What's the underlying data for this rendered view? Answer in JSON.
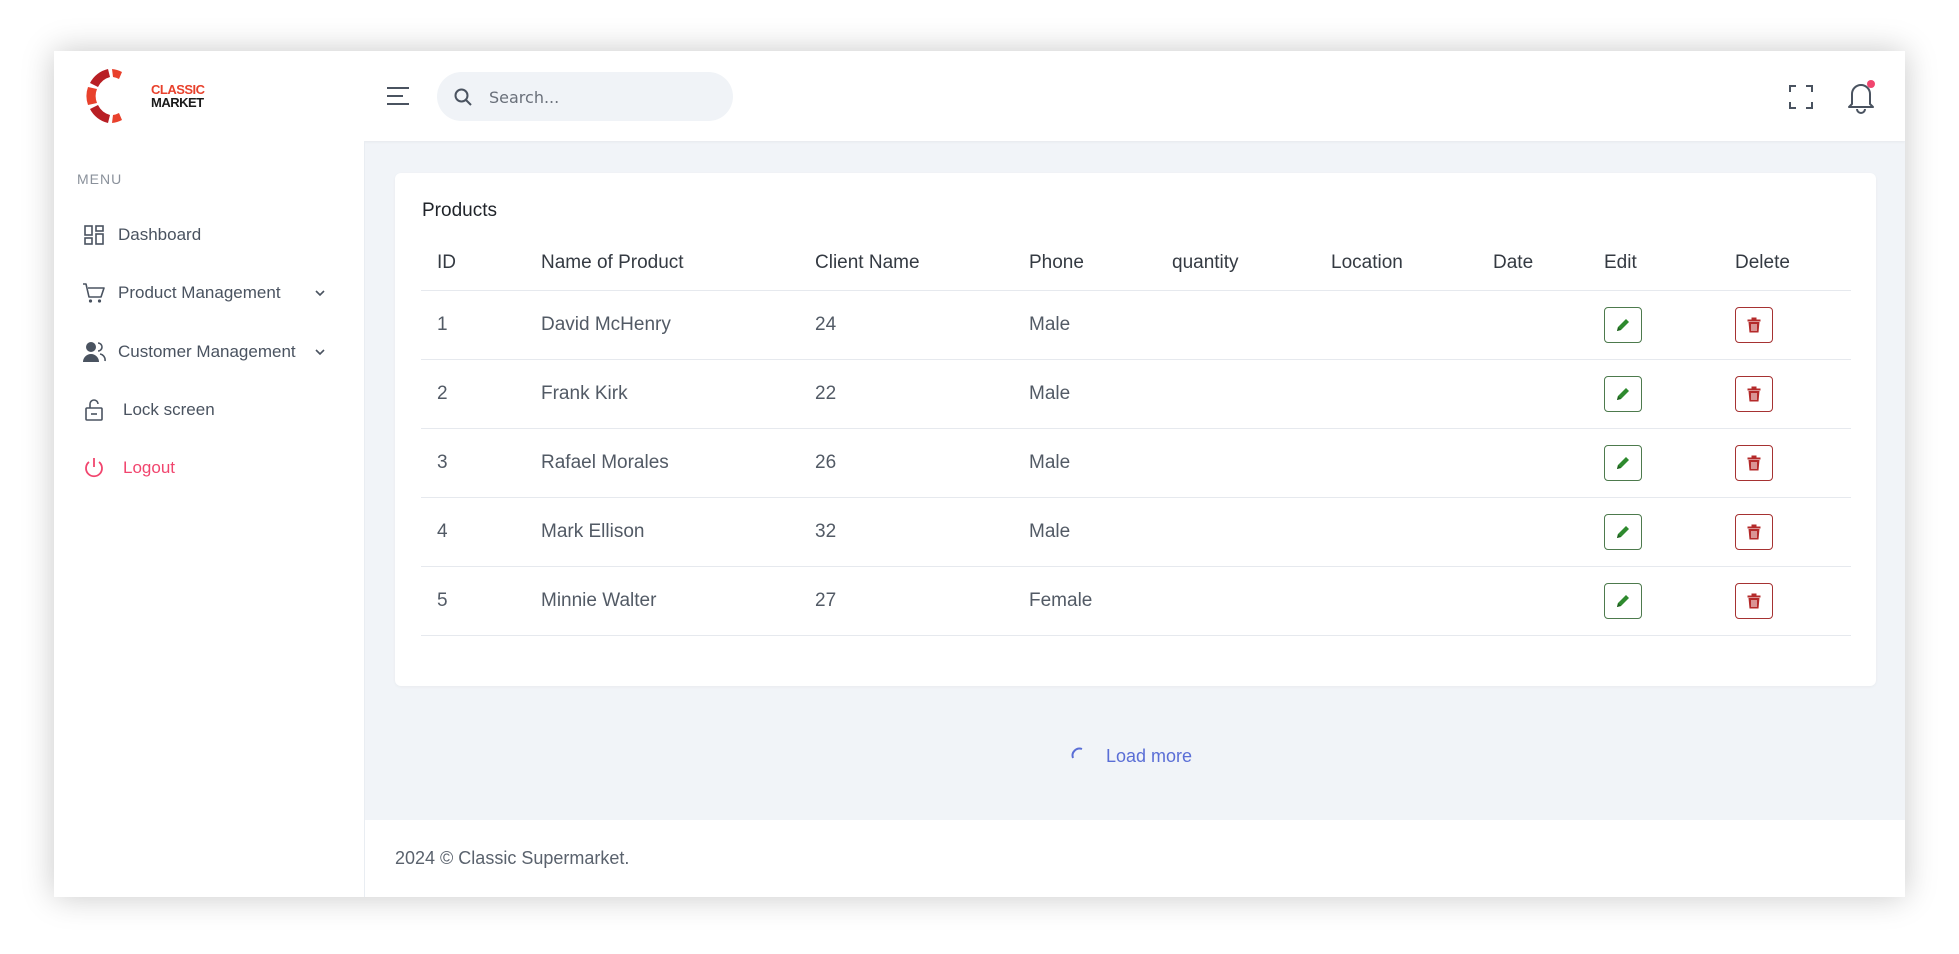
{
  "brand": {
    "line1": "CLASSIC",
    "line2": "MARKET",
    "colors": {
      "red": "#e8412c",
      "dark_red": "#b81f24",
      "black": "#1b1b1b"
    }
  },
  "header": {
    "search_placeholder": "Search...",
    "menu_icon": "hamburger-icon",
    "fullscreen_icon": "fullscreen-icon",
    "notification_icon": "bell-icon",
    "notification_dot_color": "#f1456e"
  },
  "sidebar": {
    "menu_title": "MENU",
    "items": [
      {
        "label": "Dashboard",
        "icon": "dashboard-icon",
        "has_submenu": false
      },
      {
        "label": "Product Management",
        "icon": "cart-icon",
        "has_submenu": true
      },
      {
        "label": "Customer Management",
        "icon": "users-icon",
        "has_submenu": true
      },
      {
        "label": "Lock screen",
        "icon": "lock-icon",
        "has_submenu": false
      },
      {
        "label": "Logout",
        "icon": "power-icon",
        "has_submenu": false
      }
    ],
    "logout_color": "#f1456e"
  },
  "products": {
    "title": "Products",
    "columns": [
      "ID",
      "Name of Product",
      "Client Name",
      "Phone",
      "quantity",
      "Location",
      "Date",
      "Edit",
      "Delete"
    ],
    "rows": [
      {
        "id": "1",
        "name": "David McHenry",
        "client": "24",
        "phone": "Male",
        "quantity": "",
        "location": "",
        "date": ""
      },
      {
        "id": "2",
        "name": "Frank Kirk",
        "client": "22",
        "phone": "Male",
        "quantity": "",
        "location": "",
        "date": ""
      },
      {
        "id": "3",
        "name": "Rafael Morales",
        "client": "26",
        "phone": "Male",
        "quantity": "",
        "location": "",
        "date": ""
      },
      {
        "id": "4",
        "name": "Mark Ellison",
        "client": "32",
        "phone": "Male",
        "quantity": "",
        "location": "",
        "date": ""
      },
      {
        "id": "5",
        "name": "Minnie Walter",
        "client": "27",
        "phone": "Female",
        "quantity": "",
        "location": "",
        "date": ""
      }
    ],
    "edit_icon": "pencil-icon",
    "delete_icon": "trash-icon",
    "edit_color": "#2e8a2e",
    "delete_color": "#b42a2a"
  },
  "load_more": {
    "label": "Load more",
    "color": "#5a6ed6"
  },
  "footer": {
    "text": "2024 © Classic Supermarket."
  }
}
